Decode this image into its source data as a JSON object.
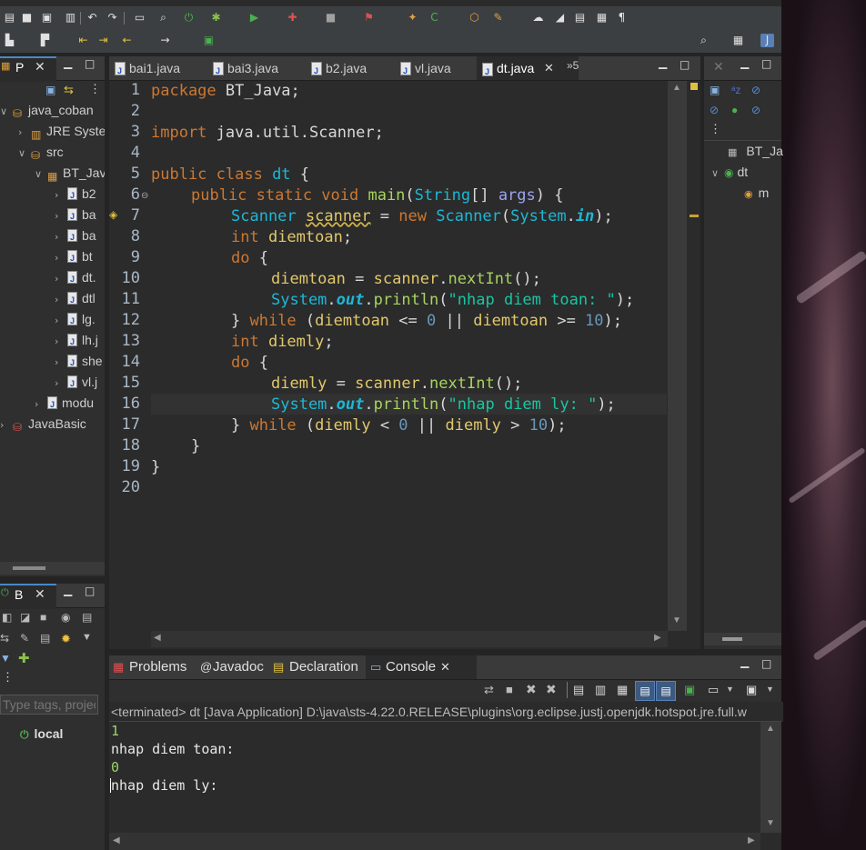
{
  "editor": {
    "tabs": [
      {
        "label": "bai1.java"
      },
      {
        "label": "bai3.java"
      },
      {
        "label": "b2.java"
      },
      {
        "label": "vl.java"
      },
      {
        "label": "dt.java",
        "active": true
      }
    ],
    "overflow_label": "»5",
    "line_numbers": [
      "1",
      "2",
      "3",
      "4",
      "5",
      "6",
      "7",
      "8",
      "9",
      "10",
      "11",
      "12",
      "13",
      "14",
      "15",
      "16",
      "17",
      "18",
      "19",
      "20"
    ],
    "code": {
      "l1a": "package",
      "l1b": " BT_Java;",
      "l3a": "import",
      "l3b": " java.util.Scanner;",
      "l5a": "public class",
      "l5b": " dt",
      "l5c": " {",
      "l6a": "public static void",
      "l6b": " main",
      "l6c": "(",
      "l6d": "String",
      "l6e": "[] ",
      "l6f": "args",
      "l6g": ") {",
      "l7a": "Scanner",
      "l7b": "scanner",
      "l7c": " = ",
      "l7d": "new",
      "l7e": " Scanner",
      "l7f": "(",
      "l7g": "System",
      "l7h": ".",
      "l7i": "in",
      "l7j": ");",
      "l8a": "int",
      "l8b": " diemtoan",
      "l8c": ";",
      "l9a": "do",
      "l9b": " {",
      "l10a": "diemtoan",
      "l10b": " = ",
      "l10c": "scanner",
      "l10d": ".",
      "l10e": "nextInt",
      "l10f": "();",
      "l11a": "System",
      "l11b": ".",
      "l11c": "out",
      "l11d": ".",
      "l11e": "println",
      "l11f": "(",
      "l11g": "\"nhap diem toan: \"",
      "l11h": ");",
      "l12a": "} ",
      "l12b": "while",
      "l12c": " (",
      "l12d": "diemtoan",
      "l12e": " <= ",
      "l12f": "0",
      "l12g": " || ",
      "l12h": "diemtoan",
      "l12i": " >= ",
      "l12j": "10",
      "l12k": ");",
      "l13a": "int",
      "l13b": " diemly",
      "l13c": ";",
      "l14a": "do",
      "l14b": " {",
      "l15a": "diemly",
      "l15b": " = ",
      "l15c": "scanner",
      "l15d": ".",
      "l15e": "nextInt",
      "l15f": "();",
      "l16a": "System",
      "l16b": ".",
      "l16c": "out",
      "l16d": ".",
      "l16e": "println",
      "l16f": "(",
      "l16g": "\"nhap diem ly: \"",
      "l16h": ");",
      "l17a": "} ",
      "l17b": "while",
      "l17c": " (",
      "l17d": "diemly",
      "l17e": " < ",
      "l17f": "0",
      "l17g": " || ",
      "l17h": "diemly",
      "l17i": " > ",
      "l17j": "10",
      "l17k": ");",
      "l18": "}",
      "l19": "}"
    }
  },
  "package_explorer": {
    "tab_label": "P",
    "items": [
      {
        "label": "java_coban"
      },
      {
        "label": "JRE Syste"
      },
      {
        "label": "src"
      },
      {
        "label": "BT_Jav"
      },
      {
        "label": "b2"
      },
      {
        "label": "ba"
      },
      {
        "label": "ba"
      },
      {
        "label": "bt"
      },
      {
        "label": "dt."
      },
      {
        "label": "dtl"
      },
      {
        "label": "lg."
      },
      {
        "label": "lh.j"
      },
      {
        "label": "she"
      },
      {
        "label": "vl.j"
      },
      {
        "label": "modu"
      },
      {
        "label": "JavaBasic"
      }
    ]
  },
  "boot_dashboard": {
    "tab_label": "B",
    "filter_placeholder": "Type tags, projec",
    "local_label": "local"
  },
  "outline": {
    "items": [
      {
        "label": "BT_Ja"
      },
      {
        "label": "dt"
      },
      {
        "label": "m"
      }
    ]
  },
  "bottom": {
    "tabs": [
      {
        "label": "Problems"
      },
      {
        "label": "Javadoc"
      },
      {
        "label": "Declaration"
      },
      {
        "label": "Console",
        "active": true
      }
    ],
    "console_header": "<terminated> dt [Java Application] D:\\java\\sts-4.22.0.RELEASE\\plugins\\org.eclipse.justj.openjdk.hotspot.jre.full.w",
    "console_lines": [
      "1",
      "nhap diem toan:",
      "0",
      "nhap diem ly:"
    ]
  }
}
